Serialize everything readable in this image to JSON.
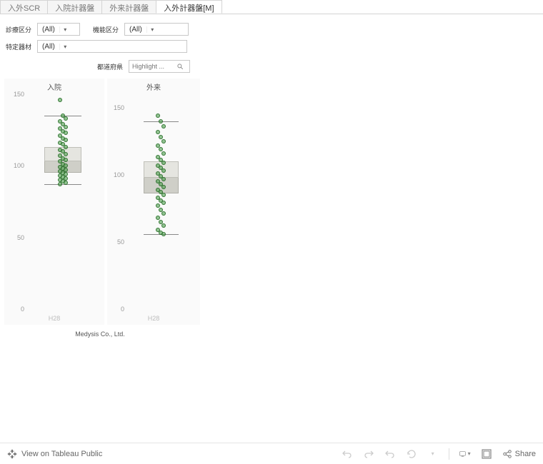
{
  "tabs": [
    {
      "label": "入外SCR",
      "active": false
    },
    {
      "label": "入院計器盤",
      "active": false
    },
    {
      "label": "外来計器盤",
      "active": false
    },
    {
      "label": "入外計器盤[M]",
      "active": true
    }
  ],
  "filters": {
    "shinryo": {
      "label": "診療区分",
      "value": "(All)"
    },
    "kinou": {
      "label": "機能区分",
      "value": "(All)"
    },
    "tokutei": {
      "label": "特定器材",
      "value": "(All)"
    },
    "todofuken": {
      "label": "都道府県",
      "placeholder": "Highlight ..."
    }
  },
  "credit": "Medysis Co., Ltd.",
  "toolbar": {
    "view_label": "View on Tableau Public",
    "share_label": "Share"
  },
  "chart_data": [
    {
      "type": "boxplot",
      "title": "入院",
      "categories": [
        "H28"
      ],
      "ylim": [
        0,
        150
      ],
      "yticks": [
        0,
        50,
        100,
        150
      ],
      "box": {
        "min": 87,
        "q1": 95,
        "median": 103,
        "q3": 113,
        "max": 135
      },
      "outliers": [],
      "points": [
        146,
        135,
        133,
        131,
        129,
        127,
        126,
        124,
        123,
        121,
        119,
        118,
        116,
        115,
        113,
        111,
        110,
        108,
        107,
        105,
        104,
        103,
        101,
        100,
        99,
        98,
        97,
        96,
        95,
        94,
        93,
        92,
        91,
        90,
        89,
        88,
        87
      ]
    },
    {
      "type": "boxplot",
      "title": "外来",
      "categories": [
        "H28"
      ],
      "ylim": [
        0,
        160
      ],
      "yticks": [
        0,
        50,
        100,
        150
      ],
      "box": {
        "min": 56,
        "q1": 86,
        "median": 98,
        "q3": 110,
        "max": 140
      },
      "outliers": [],
      "points": [
        144,
        140,
        136,
        132,
        128,
        125,
        122,
        119,
        116,
        113,
        111,
        109,
        107,
        105,
        103,
        101,
        99,
        97,
        95,
        93,
        91,
        89,
        87,
        85,
        83,
        81,
        79,
        77,
        74,
        71,
        68,
        65,
        62,
        59,
        57,
        56
      ]
    }
  ]
}
